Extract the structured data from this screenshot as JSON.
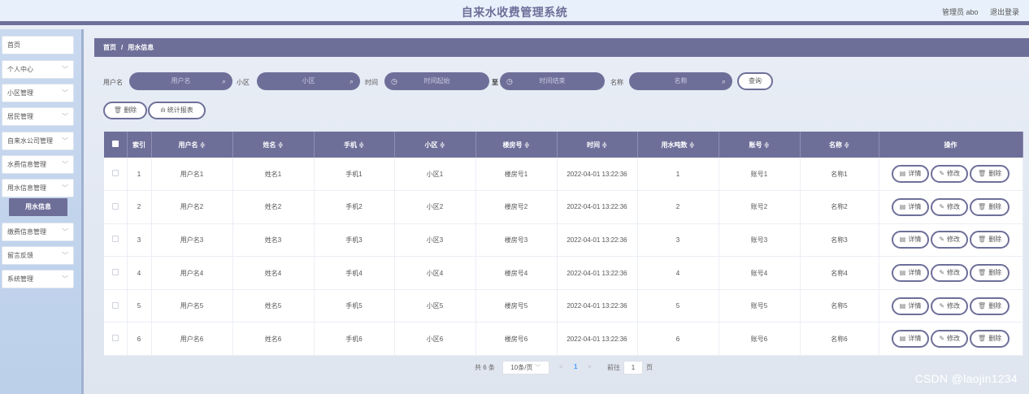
{
  "header": {
    "title": "自来水收费管理系统",
    "user_role": "管理员 abo",
    "logout": "退出登录"
  },
  "sidebar": {
    "items": [
      {
        "label": "首页",
        "chev": ""
      },
      {
        "label": "个人中心",
        "chev": "﹀"
      },
      {
        "label": "小区管理",
        "chev": "﹀"
      },
      {
        "label": "居民管理",
        "chev": "﹀"
      },
      {
        "label": "自来水公司管理",
        "chev": "﹀"
      },
      {
        "label": "水费信息管理",
        "chev": "﹀"
      },
      {
        "label": "用水信息管理",
        "chev": "﹀"
      },
      {
        "label": "缴费信息管理",
        "chev": "﹀"
      },
      {
        "label": "留言反馈",
        "chev": "﹀"
      },
      {
        "label": "系统管理",
        "chev": "﹀"
      }
    ],
    "active_sub": "用水信息"
  },
  "breadcrumb": {
    "home": "首页",
    "sep": "/",
    "current": "用水信息"
  },
  "search": {
    "username_label": "用户名",
    "username_placeholder": "用户名",
    "community_label": "小区",
    "community_placeholder": "小区",
    "time_label": "时间",
    "time_start_placeholder": "时间起始",
    "to": "至",
    "time_end_placeholder": "时间结束",
    "name_label": "名称",
    "name_placeholder": "名称",
    "query_button": "查询"
  },
  "toolbar": {
    "delete": "删除",
    "stats": "统计报表"
  },
  "table": {
    "headers": [
      "索引",
      "用户名 ≑",
      "姓名 ≑",
      "手机 ≑",
      "小区 ≑",
      "楼房号 ≑",
      "时间 ≑",
      "用水吨数 ≑",
      "账号 ≑",
      "名称 ≑",
      "操作"
    ],
    "rows": [
      {
        "idx": "1",
        "username": "用户名1",
        "name": "姓名1",
        "phone": "手机1",
        "community": "小区1",
        "room": "楼房号1",
        "time": "2022-04-01 13:22:36",
        "tons": "1",
        "account": "账号1",
        "title": "名称1"
      },
      {
        "idx": "2",
        "username": "用户名2",
        "name": "姓名2",
        "phone": "手机2",
        "community": "小区2",
        "room": "楼房号2",
        "time": "2022-04-01 13:22:36",
        "tons": "2",
        "account": "账号2",
        "title": "名称2"
      },
      {
        "idx": "3",
        "username": "用户名3",
        "name": "姓名3",
        "phone": "手机3",
        "community": "小区3",
        "room": "楼房号3",
        "time": "2022-04-01 13:22:36",
        "tons": "3",
        "account": "账号3",
        "title": "名称3"
      },
      {
        "idx": "4",
        "username": "用户名4",
        "name": "姓名4",
        "phone": "手机4",
        "community": "小区4",
        "room": "楼房号4",
        "time": "2022-04-01 13:22:36",
        "tons": "4",
        "account": "账号4",
        "title": "名称4"
      },
      {
        "idx": "5",
        "username": "用户名5",
        "name": "姓名5",
        "phone": "手机5",
        "community": "小区5",
        "room": "楼房号5",
        "time": "2022-04-01 13:22:36",
        "tons": "5",
        "account": "账号5",
        "title": "名称5"
      },
      {
        "idx": "6",
        "username": "用户名6",
        "name": "姓名6",
        "phone": "手机6",
        "community": "小区6",
        "room": "楼房号6",
        "time": "2022-04-01 13:22:36",
        "tons": "6",
        "account": "账号6",
        "title": "名称6"
      }
    ],
    "actions": {
      "detail": "详情",
      "edit": "修改",
      "delete": "删除"
    }
  },
  "pagination": {
    "total": "共 6 条",
    "page_size": "10条/页",
    "prev": "<",
    "current_page": "1",
    "next": ">",
    "goto_label": "前往",
    "goto_value": "1",
    "page_unit": "页"
  },
  "watermark": "CSDN @laojin1234",
  "colors": {
    "accent": "#6e6f99"
  }
}
